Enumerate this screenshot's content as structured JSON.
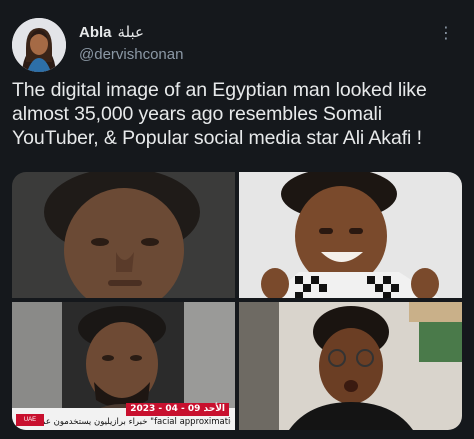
{
  "author": {
    "display_name": "Abla",
    "display_name_ar": "عبلة",
    "handle": "@dervishconan"
  },
  "more_icon": "more-options-icon",
  "tweet": {
    "text": "The digital image of an Egyptian man looked like almost 35,000 years ago resembles Somali YouTuber, & Popular social media star Ali Akafi !"
  },
  "media": {
    "news_overlay": {
      "date": "الأحد 09 - 04 - 2023",
      "ticker": "خبراء برازيليون يستخدمون عملية \"facial approximation\" لإعادة بناء",
      "logo": "UAE"
    }
  }
}
